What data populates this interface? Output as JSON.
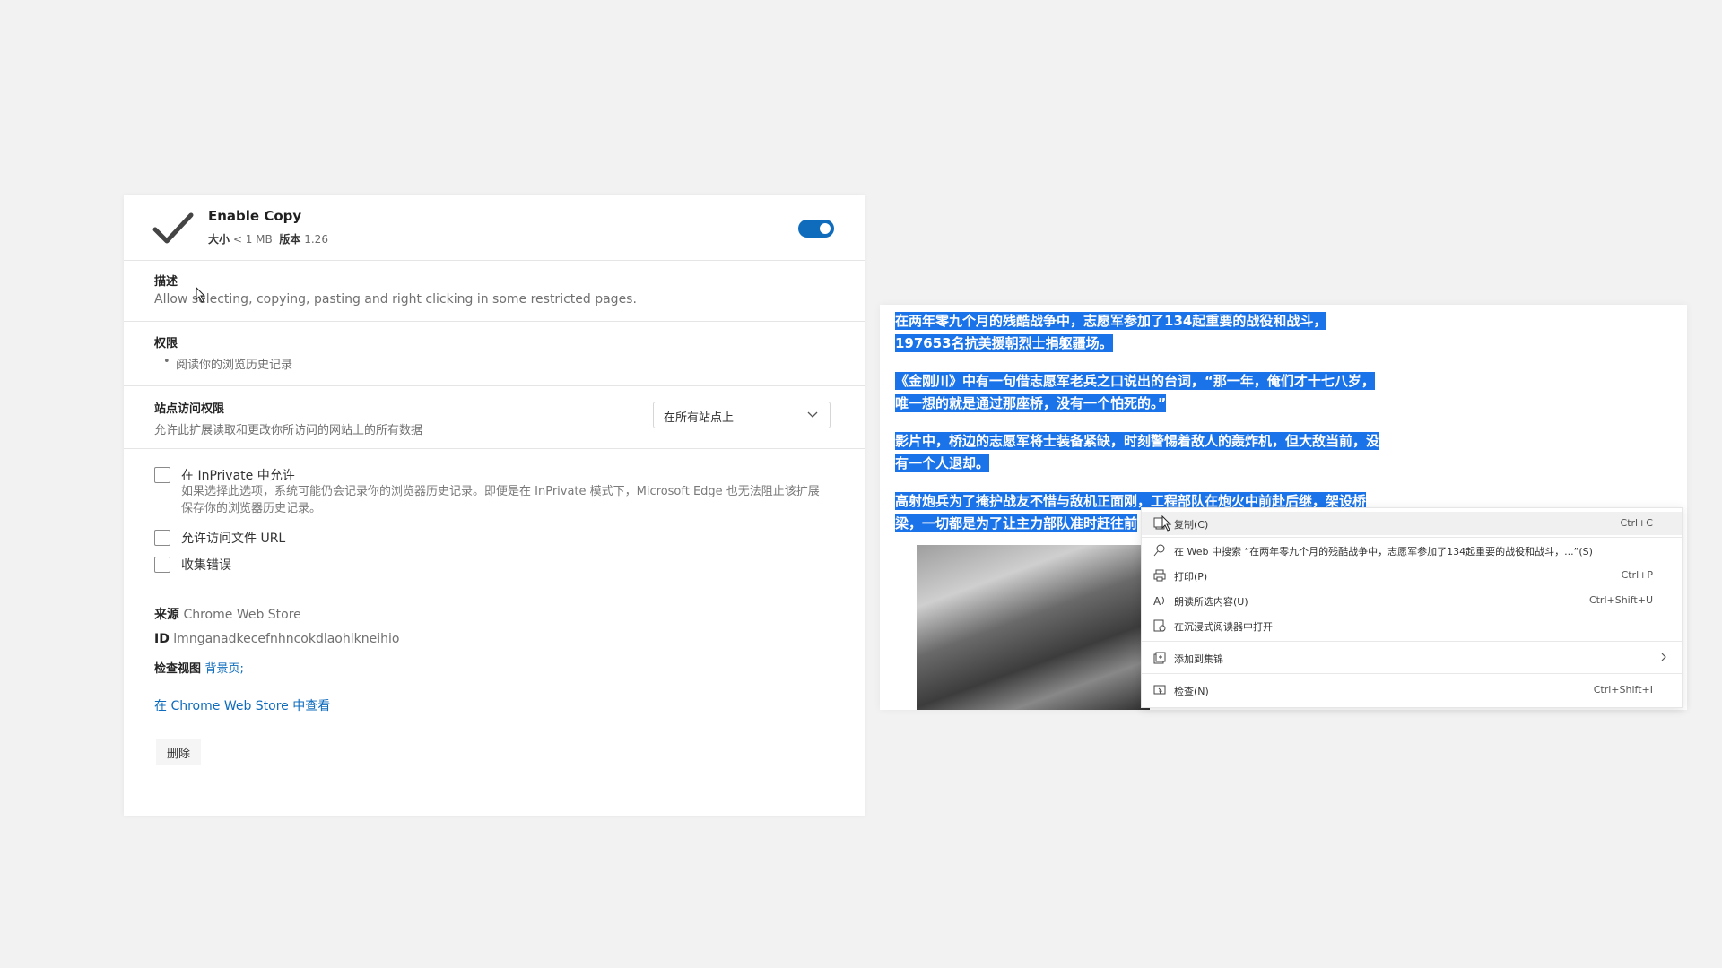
{
  "extension": {
    "name": "Enable Copy",
    "size_label": "大小",
    "size_value": "< 1 MB",
    "version_label": "版本",
    "version_value": "1.26",
    "enabled": true
  },
  "description": {
    "title": "描述",
    "text": "Allow selecting, copying, pasting and right clicking in some restricted pages."
  },
  "permissions": {
    "title": "权限",
    "items": [
      "阅读你的浏览历史记录"
    ]
  },
  "site_access": {
    "title": "站点访问权限",
    "desc": "允许此扩展读取和更改你所访问的网站上的所有数据",
    "selected": "在所有站点上"
  },
  "options": [
    {
      "label": "在 InPrivate 中允许",
      "checked": false,
      "desc": "如果选择此选项，系统可能仍会记录你的浏览器历史记录。即便是在 InPrivate 模式下，Microsoft Edge 也无法阻止该扩展保存你的浏览器历史记录。"
    },
    {
      "label": "允许访问文件 URL",
      "checked": false
    },
    {
      "label": "收集错误",
      "checked": false
    }
  ],
  "info": {
    "source_label": "来源",
    "source_value": "Chrome Web Store",
    "id_label": "ID",
    "id_value": "lmnganadkecefnhncokdlaohlkneihio",
    "inspect_label": "检查视图",
    "inspect_link": "背景页;",
    "store_link": "在 Chrome Web Store 中查看",
    "delete_label": "删除"
  },
  "web_page": {
    "paragraphs": [
      "在两年零九个月的残酷战争中，志愿军参加了134起重要的战役和战斗，197653名抗美援朝烈士捐躯疆场。",
      "《金刚川》中有一句借志愿军老兵之口说出的台词，“那一年，俺们才十七八岁，唯一想的就是通过那座桥，没有一个怕死的。”",
      "影片中，桥边的志愿军将士装备紧缺，时刻警惕着敌人的轰炸机，但大敌当前，没有一个人退却。",
      "高射炮兵为了掩护战友不惜与敌机正面刚，工程部队在炮火中前赴后继，架设桥梁，一切都是为了让主力部队准时赶往前"
    ]
  },
  "context_menu": {
    "items": [
      {
        "icon": "copy-icon",
        "label": "复制(C)",
        "shortcut": "Ctrl+C"
      },
      {
        "icon": "search-icon",
        "label": "在 Web 中搜索 “在两年零九个月的残酷战争中，志愿军参加了134起重要的战役和战斗，...”(S)",
        "shortcut": ""
      },
      {
        "icon": "print-icon",
        "label": "打印(P)",
        "shortcut": "Ctrl+P"
      },
      {
        "icon": "read-aloud-icon",
        "label": "朗读所选内容(U)",
        "shortcut": "Ctrl+Shift+U"
      },
      {
        "icon": "immersive-reader-icon",
        "label": "在沉浸式阅读器中打开",
        "shortcut": ""
      },
      {
        "icon": "collections-icon",
        "label": "添加到集锦",
        "shortcut": ""
      },
      {
        "icon": "inspect-icon",
        "label": "检查(N)",
        "shortcut": "Ctrl+Shift+I"
      }
    ]
  }
}
